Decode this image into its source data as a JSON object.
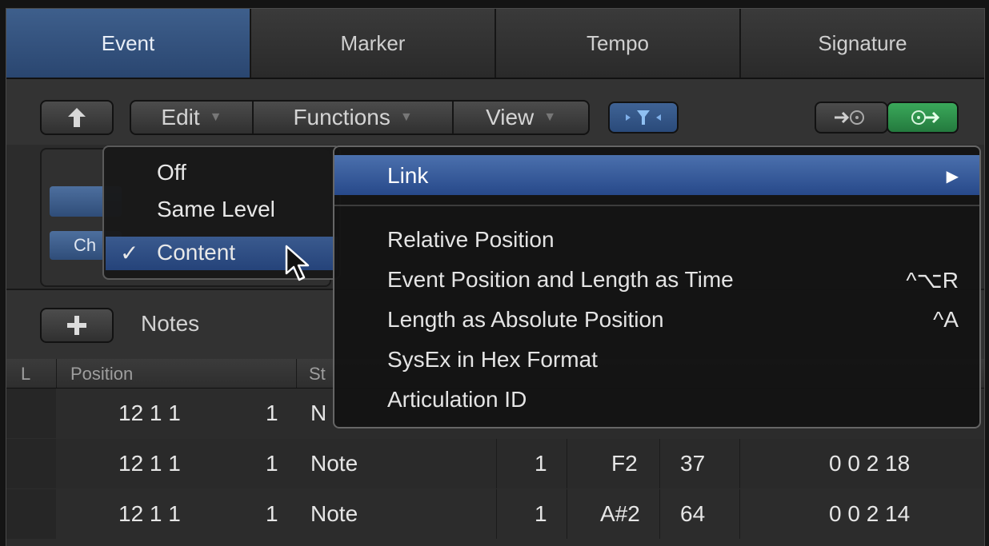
{
  "tabs": [
    "Event",
    "Marker",
    "Tempo",
    "Signature"
  ],
  "toolbar": {
    "edit_label": "Edit",
    "functions_label": "Functions",
    "view_label": "View"
  },
  "left_menu": {
    "items": [
      "Off",
      "Same Level",
      "Content"
    ],
    "checked_item": "Content",
    "check_mark": "✓"
  },
  "hidden_button_fragment": "Ch",
  "right_menu": {
    "submenu_item": "Link",
    "items": [
      {
        "label": "Relative Position",
        "shortcut": ""
      },
      {
        "label": "Event Position and Length as Time",
        "shortcut": "^⌥R"
      },
      {
        "label": "Length as Absolute Position",
        "shortcut": "^A"
      },
      {
        "label": "SysEx in Hex Format",
        "shortcut": ""
      },
      {
        "label": "Articulation ID",
        "shortcut": ""
      }
    ]
  },
  "notes_header": {
    "label": "Notes"
  },
  "columns": [
    "L",
    "Position",
    "St"
  ],
  "rows": [
    {
      "pos": "12  1  1",
      "tick": "1",
      "status": "N",
      "ch": "",
      "num": "",
      "val": "",
      "len": ""
    },
    {
      "pos": "12  1  1",
      "tick": "1",
      "status": "Note",
      "ch": "1",
      "num": "F2",
      "val": "37",
      "len": "0  0  2  18"
    },
    {
      "pos": "12  1  1",
      "tick": "1",
      "status": "Note",
      "ch": "1",
      "num": "A#2",
      "val": "64",
      "len": "0  0  2  14"
    }
  ],
  "colors": {
    "accent_blue": "#2a4670",
    "menu_highlight": "#27498a",
    "active_green": "#2f8a4a"
  }
}
